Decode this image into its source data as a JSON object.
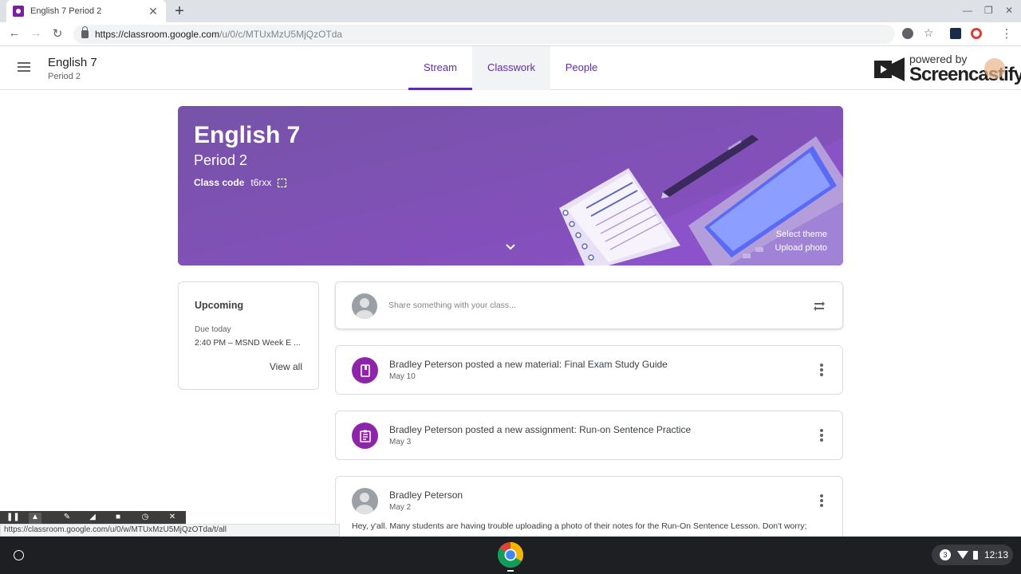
{
  "browser": {
    "tab_title": "English 7 Period 2",
    "url_host": "https://classroom.google.com",
    "url_path": "/u/0/c/MTUxMzU5MjQzOTda",
    "status_url": "https://classroom.google.com/u/0/w/MTUxMzU5MjQzOTda/t/all"
  },
  "header": {
    "class_name": "English 7",
    "section": "Period 2",
    "tabs": [
      {
        "label": "Stream"
      },
      {
        "label": "Classwork"
      },
      {
        "label": "People"
      }
    ],
    "watermark_small": "powered by",
    "watermark_big": "Screencastify"
  },
  "banner": {
    "title": "English 7",
    "subtitle": "Period 2",
    "class_code_label": "Class code",
    "class_code": "t6rxx",
    "select_theme": "Select theme",
    "upload_photo": "Upload photo"
  },
  "upcoming": {
    "title": "Upcoming",
    "due_label": "Due today",
    "item": "2:40 PM – MSND Week E ...",
    "view_all": "View all"
  },
  "share": {
    "placeholder": "Share something with your class..."
  },
  "posts": [
    {
      "text": "Bradley Peterson posted a new material: Final Exam Study Guide",
      "date": "May 10"
    },
    {
      "text": "Bradley Peterson posted a new assignment: Run-on Sentence Practice",
      "date": "May 3"
    },
    {
      "text": "Bradley Peterson",
      "date": "May 2",
      "body": "Hey, y'all. Many students are having trouble uploading a photo of their notes for the Run-On Sentence Lesson. Don't worry;"
    }
  ],
  "shelf": {
    "notification_count": "3",
    "time": "12:13"
  },
  "colors": {
    "accent": "#5f2da4",
    "banner": "#7b52ab",
    "post_icon": "#8e24aa"
  }
}
